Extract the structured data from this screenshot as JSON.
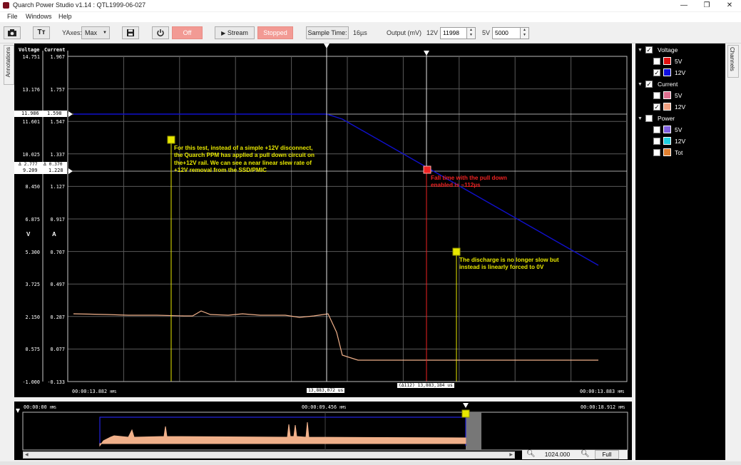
{
  "window": {
    "title": "Quarch Power Studio v1.14 : QTL1999-06-027",
    "minimize": "—",
    "restore": "❐",
    "close": "✕"
  },
  "menu": [
    "File",
    "Windows",
    "Help"
  ],
  "toolbar": {
    "camera_icon": "camera-icon",
    "text_button": "Tт",
    "yaxes_label": "YAxes:",
    "yaxes_value": "Max",
    "power_off": "Off",
    "stream_label": "Stream",
    "stopped_label": "Stopped",
    "sample_time_label": "Sample Time:",
    "sample_time_value": "16µs",
    "output_label": "Output (mV)",
    "v12_label": "12V",
    "v12_value": "11998",
    "v5_label": "5V",
    "v5_value": "5000"
  },
  "side_tabs": {
    "annotations": "Annotations",
    "channels": "Channels"
  },
  "plot": {
    "voltage_header": "Voltage",
    "current_header": "Current",
    "voltage_ticks": [
      "14.751",
      "13.176",
      "11.601",
      "10.025",
      "8.450",
      "6.875",
      "5.300",
      "3.725",
      "2.150",
      "0.575",
      "-1.000"
    ],
    "current_ticks": [
      "1.967",
      "1.757",
      "1.547",
      "1.337",
      "1.127",
      "0.917",
      "0.707",
      "0.497",
      "0.287",
      "0.077",
      "-0.133"
    ],
    "v_unit": "V",
    "a_unit": "A",
    "marker_v1": "11.986",
    "marker_a1": "1.598",
    "marker_delta_v": "Δ 2.777",
    "marker_delta_a": "Δ 0.370",
    "marker_v2": "9.209",
    "marker_a2": "1.228",
    "time_left": "00:00:13.882",
    "time_right": "00:00:13.883",
    "time_unit": "HMS",
    "cursor1_time": "13,883,072 us",
    "cursor2_time": "(Δ112) 13,883,184 us",
    "annotation1": [
      "For this test, instead of a simple +12V disconnect,",
      "the Quarch PPM has applied a pull down circuit on",
      "the+12V rail. We can see a near linear slew rate of",
      "+12V removal from the SSD/PMIC"
    ],
    "annotation2": [
      "Fall time with the pull down",
      "enabled is ~112µs"
    ],
    "annotation3": [
      "The discharge is no longer slow but",
      "instead is linearly forced to 0V"
    ],
    "colors": {
      "voltage_12v": "#1010cc",
      "current_12v": "#f0b08a",
      "annotation_yellow": "#e8e800",
      "annotation_red": "#ee2222",
      "grid": "#5a5a5a"
    }
  },
  "overview": {
    "time_start": "00:00:00",
    "time_mid": "00:00:09.456",
    "time_end": "00:00:18.912",
    "time_unit": "HMS",
    "zoom_value": "1024.000",
    "full_label": "Full"
  },
  "channels": {
    "voltage": {
      "label": "Voltage",
      "checked": true,
      "items": [
        {
          "label": "5V",
          "checked": false,
          "color": "#e01010"
        },
        {
          "label": "12V",
          "checked": true,
          "color": "#1010e0"
        }
      ]
    },
    "current": {
      "label": "Current",
      "checked": true,
      "items": [
        {
          "label": "5V",
          "checked": false,
          "color": "#e07090"
        },
        {
          "label": "12V",
          "checked": true,
          "color": "#f0a080"
        }
      ]
    },
    "power": {
      "label": "Power",
      "checked": false,
      "items": [
        {
          "label": "5V",
          "checked": false,
          "color": "#8060e0"
        },
        {
          "label": "12V",
          "checked": false,
          "color": "#20d0e0"
        },
        {
          "label": "Tot",
          "checked": false,
          "color": "#e08030"
        }
      ]
    }
  }
}
